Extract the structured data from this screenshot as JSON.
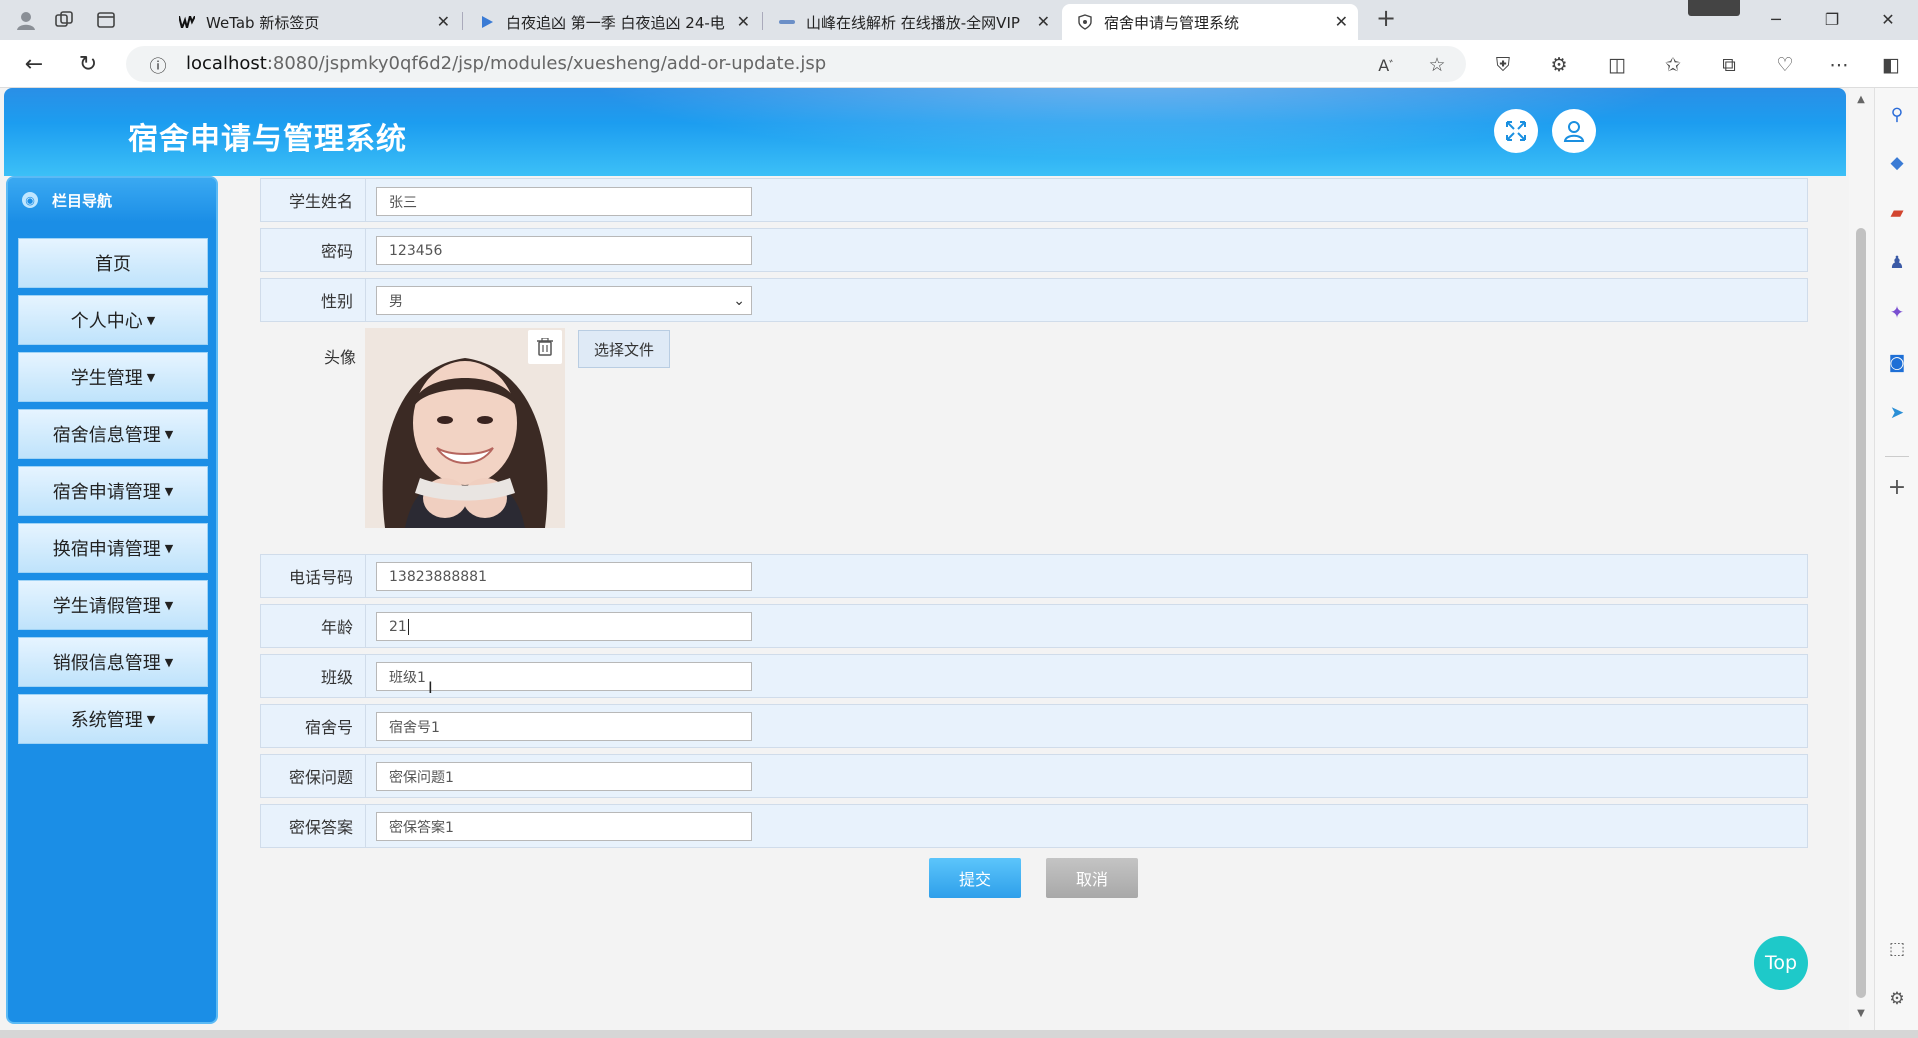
{
  "browser": {
    "tabs": [
      {
        "title": "WeTab 新标签页",
        "favicon": "wetab-icon",
        "active": false
      },
      {
        "title": "白夜追凶 第一季 白夜追凶 24-电",
        "favicon": "play-icon",
        "active": false
      },
      {
        "title": "山峰在线解析 在线播放-全网VIP",
        "favicon": "link-icon",
        "active": false
      },
      {
        "title": "宿舍申请与管理系统",
        "favicon": "shield-icon",
        "active": true
      }
    ],
    "url_host": "localhost",
    "url_path": ":8080/jspmky0qf6d2/jsp/modules/xuesheng/add-or-update.jsp"
  },
  "app": {
    "title": "宿舍申请与管理系统"
  },
  "sidebar": {
    "heading": "栏目导航",
    "items": [
      {
        "label": "首页",
        "has_caret": false
      },
      {
        "label": "个人中心",
        "has_caret": true
      },
      {
        "label": "学生管理",
        "has_caret": true
      },
      {
        "label": "宿舍信息管理",
        "has_caret": true
      },
      {
        "label": "宿舍申请管理",
        "has_caret": true
      },
      {
        "label": "换宿申请管理",
        "has_caret": true
      },
      {
        "label": "学生请假管理",
        "has_caret": true
      },
      {
        "label": "销假信息管理",
        "has_caret": true
      },
      {
        "label": "系统管理",
        "has_caret": true
      }
    ]
  },
  "form": {
    "name": {
      "label": "学生姓名",
      "value": "张三"
    },
    "password": {
      "label": "密码",
      "value": "123456"
    },
    "gender": {
      "label": "性别",
      "value": "男"
    },
    "avatar": {
      "label": "头像",
      "file_button": "选择文件"
    },
    "phone": {
      "label": "电话号码",
      "value": "13823888881"
    },
    "age": {
      "label": "年龄",
      "value": "21"
    },
    "class": {
      "label": "班级",
      "value": "班级1"
    },
    "dorm": {
      "label": "宿舍号",
      "value": "宿舍号1"
    },
    "question": {
      "label": "密保问题",
      "value": "密保问题1"
    },
    "answer": {
      "label": "密保答案",
      "value": "密保答案1"
    },
    "submit": "提交",
    "cancel": "取消"
  },
  "top_button": "Top",
  "colors": {
    "header_blue": "#1c9df0",
    "nav_blue": "#1b8ee6",
    "row_bg": "#e8f2fc",
    "top_teal": "#1ec9c9"
  }
}
